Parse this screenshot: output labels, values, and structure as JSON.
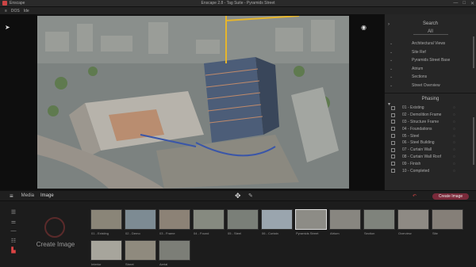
{
  "window": {
    "app_name": "Enscape",
    "title": "Enscape 2.8 - Tag Suite - Pyramids Street",
    "controls": [
      "—",
      "□",
      "✕"
    ]
  },
  "menu": [
    "≡",
    "DOS",
    "Ide"
  ],
  "right_panel": {
    "search_label": "Search",
    "filter_value": "All",
    "items_top": [
      "Architectural Views",
      "Site Ref",
      "Pyramids Street Base",
      "Atrium",
      "Sections",
      "Street Overview"
    ],
    "phase_label": "Phasing",
    "items_bottom": [
      "01 - Existing",
      "02 - Demolition Frame",
      "03 - Structure Frame",
      "04 - Foundations",
      "05 - Steel",
      "06 - Steel Building",
      "07 - Curtain Wall",
      "08 - Curtain Wall Roof",
      "09 - Finish",
      "10 - Completed"
    ]
  },
  "toolbar": {
    "breadcrumb_1": "Media",
    "breadcrumb_2": "Image",
    "render_label": "Create Image"
  },
  "bottom": {
    "create_label": "Create Image",
    "thumbs_row1": [
      "01 - Existing",
      "02 - Demo",
      "03 - Frame",
      "04 - Found",
      "05 - Steel",
      "06 - Curtain",
      "Pyramids Street",
      "Atrium",
      "Section",
      "Overview",
      "Site"
    ],
    "thumbs_row2": [
      "Interior",
      "Street",
      "Aerial"
    ]
  }
}
